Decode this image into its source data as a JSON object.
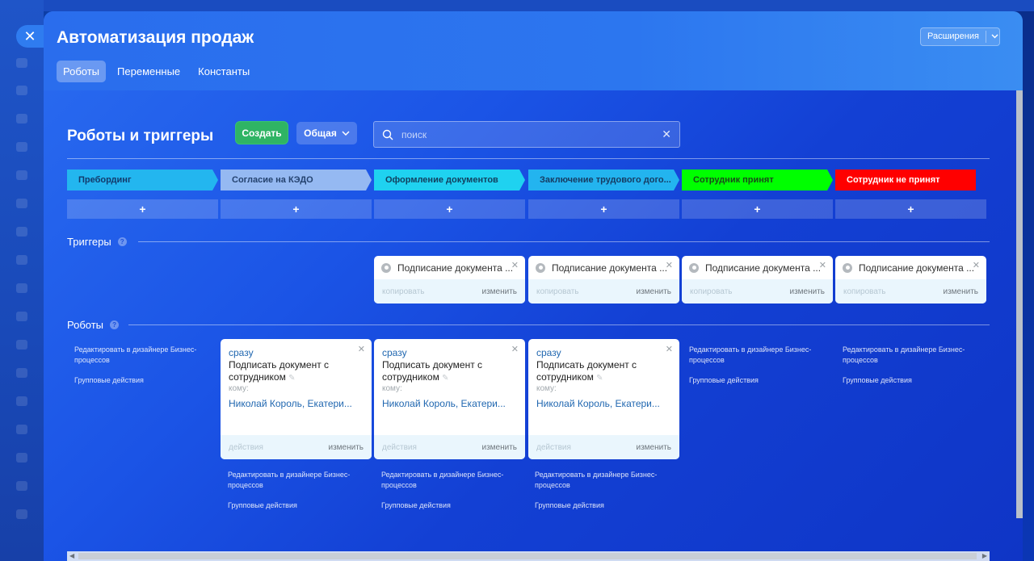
{
  "header": {
    "title": "Автоматизация продаж",
    "extensions_label": "Расширения",
    "tabs": [
      {
        "label": "Роботы",
        "active": true
      },
      {
        "label": "Переменные",
        "active": false
      },
      {
        "label": "Константы",
        "active": false
      }
    ]
  },
  "toolbar": {
    "section_title": "Роботы и триггеры",
    "create_label": "Создать",
    "common_label": "Общая",
    "search_placeholder": "поиск"
  },
  "stages": [
    {
      "name": "Пребординг",
      "color": "#23b6ef"
    },
    {
      "name": "Согласие на КЭДО",
      "color": "#95b9f2"
    },
    {
      "name": "Оформление документов",
      "color": "#1fd2f0"
    },
    {
      "name": "Заключение трудового дого...",
      "color": "#23b4ef"
    },
    {
      "name": "Сотрудник принят",
      "color": "#00ff00"
    },
    {
      "name": "Сотрудник не принят",
      "color": "#ff0000"
    }
  ],
  "add_label": "+",
  "triggers_label": "Триггеры",
  "robots_label": "Роботы",
  "help_glyph": "?",
  "triggers": [
    {
      "title": "Подписание документа ...",
      "copy": "копировать",
      "edit": "изменить"
    },
    {
      "title": "Подписание документа ...",
      "copy": "копировать",
      "edit": "изменить"
    },
    {
      "title": "Подписание документа ...",
      "copy": "копировать",
      "edit": "изменить"
    },
    {
      "title": "Подписание документа ...",
      "copy": "копировать",
      "edit": "изменить"
    }
  ],
  "robots": [
    {
      "when": "сразу",
      "title": "Подписать документ с сотрудником",
      "to_label": "кому:",
      "to_value": "Николай Король, Екатери...",
      "actions": "действия",
      "edit": "изменить"
    },
    {
      "when": "сразу",
      "title": "Подписать документ с сотрудником",
      "to_label": "кому:",
      "to_value": "Николай Король, Екатери...",
      "actions": "действия",
      "edit": "изменить"
    },
    {
      "when": "сразу",
      "title": "Подписать документ с сотрудником",
      "to_label": "кому:",
      "to_value": "Николай Король, Екатери...",
      "actions": "действия",
      "edit": "изменить"
    }
  ],
  "links": {
    "edit_designer": "Редактировать в дизайнере Бизнес-процессов",
    "group_actions": "Групповые действия"
  }
}
